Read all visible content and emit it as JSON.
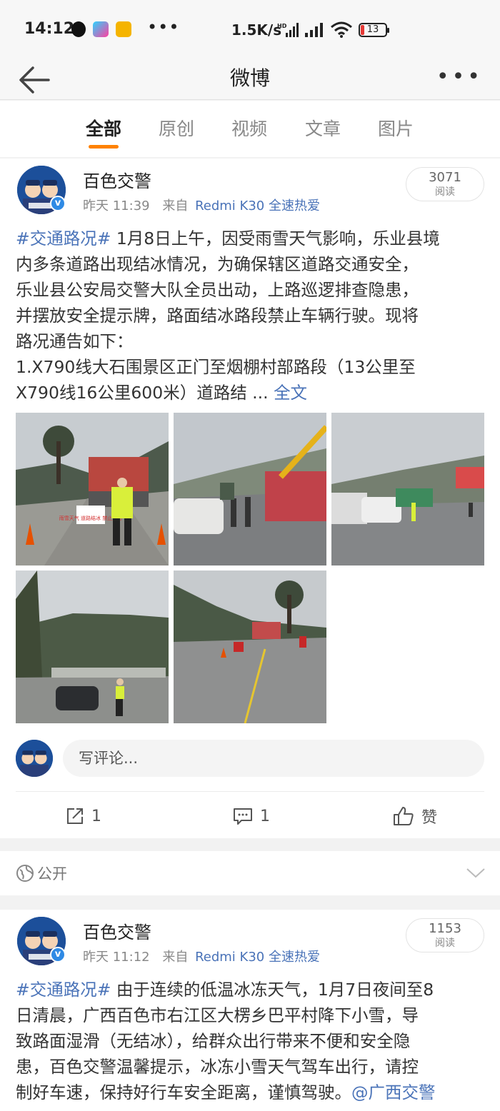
{
  "status_bar": {
    "time": "14:12",
    "speed": "1.5K/s",
    "network": "HD",
    "battery": "13",
    "more": "•••"
  },
  "navbar": {
    "title": "微博",
    "back_icon": "arrow-left-icon",
    "more_icon": "more-dots-icon",
    "more_glyph": "•••"
  },
  "tabs": [
    {
      "label": "全部",
      "active": true
    },
    {
      "label": "原创"
    },
    {
      "label": "视频"
    },
    {
      "label": "文章"
    },
    {
      "label": "图片"
    }
  ],
  "accent_color": "#ff8200",
  "link_color": "#4a73b8",
  "posts": [
    {
      "author": "百色交警",
      "time": "昨天 11:39",
      "source_prefix": "来自",
      "source": "Redmi K30 全速热爱",
      "reads": "3071",
      "reads_label": "阅读",
      "tag": "#交通路况#",
      "text_lines": [
        " 1月8日上午，因受雨雪天气影响，乐业县境",
        "内多条道路出现结冰情况，为确保辖区道路交通安全，",
        "乐业县公安局交警大队全员出动，上路巡逻排查隐患，",
        "并摆放安全提示牌，路面结冰路段禁止车辆行驶。现将",
        "路况通告如下：",
        " 1.X790线大石围景区正门至烟棚村部路段（13公里至",
        "X790线16公里600米）道路结 ... "
      ],
      "more_link": "全文",
      "photo_count": 5,
      "photo_sign": "雨雪天气 道路结冰 禁止通行",
      "comment_placeholder": "写评论...",
      "actions": {
        "repost": "1",
        "comment": "1",
        "like": "赞"
      },
      "visibility": "公开"
    },
    {
      "author": "百色交警",
      "time": "昨天 11:12",
      "source_prefix": "来自",
      "source": "Redmi K30 全速热爱",
      "reads": "1153",
      "reads_label": "阅读",
      "tag": "#交通路况#",
      "text_lines": [
        " 由于连续的低温冰冻天气，1月7日夜间至8",
        "日清晨，广西百色市右江区大楞乡巴平村降下小雪，导",
        "致路面湿滑（无结冰），给群众出行带来不便和安全隐",
        "患，百色交警温馨提示，冰冻小雪天气驾车出行，请控",
        "制好车速，保持好行车安全距离，谨慎驾驶。"
      ],
      "mention": "@广西交警"
    }
  ]
}
